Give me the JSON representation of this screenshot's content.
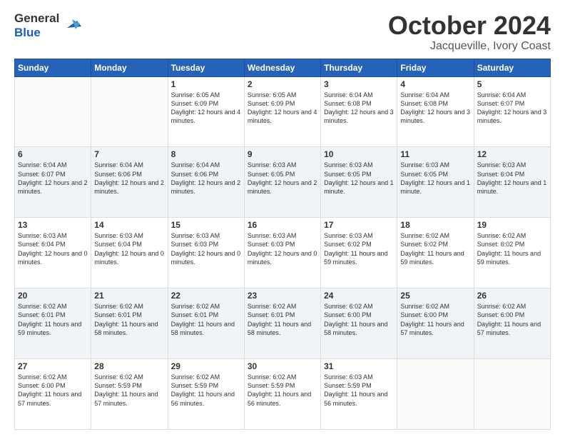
{
  "header": {
    "logo_line1": "General",
    "logo_line2": "Blue",
    "month": "October 2024",
    "location": "Jacqueville, Ivory Coast"
  },
  "days_of_week": [
    "Sunday",
    "Monday",
    "Tuesday",
    "Wednesday",
    "Thursday",
    "Friday",
    "Saturday"
  ],
  "weeks": [
    [
      {
        "day": "",
        "info": ""
      },
      {
        "day": "",
        "info": ""
      },
      {
        "day": "1",
        "info": "Sunrise: 6:05 AM\nSunset: 6:09 PM\nDaylight: 12 hours and 4 minutes."
      },
      {
        "day": "2",
        "info": "Sunrise: 6:05 AM\nSunset: 6:09 PM\nDaylight: 12 hours and 4 minutes."
      },
      {
        "day": "3",
        "info": "Sunrise: 6:04 AM\nSunset: 6:08 PM\nDaylight: 12 hours and 3 minutes."
      },
      {
        "day": "4",
        "info": "Sunrise: 6:04 AM\nSunset: 6:08 PM\nDaylight: 12 hours and 3 minutes."
      },
      {
        "day": "5",
        "info": "Sunrise: 6:04 AM\nSunset: 6:07 PM\nDaylight: 12 hours and 3 minutes."
      }
    ],
    [
      {
        "day": "6",
        "info": "Sunrise: 6:04 AM\nSunset: 6:07 PM\nDaylight: 12 hours and 2 minutes."
      },
      {
        "day": "7",
        "info": "Sunrise: 6:04 AM\nSunset: 6:06 PM\nDaylight: 12 hours and 2 minutes."
      },
      {
        "day": "8",
        "info": "Sunrise: 6:04 AM\nSunset: 6:06 PM\nDaylight: 12 hours and 2 minutes."
      },
      {
        "day": "9",
        "info": "Sunrise: 6:03 AM\nSunset: 6:05 PM\nDaylight: 12 hours and 2 minutes."
      },
      {
        "day": "10",
        "info": "Sunrise: 6:03 AM\nSunset: 6:05 PM\nDaylight: 12 hours and 1 minute."
      },
      {
        "day": "11",
        "info": "Sunrise: 6:03 AM\nSunset: 6:05 PM\nDaylight: 12 hours and 1 minute."
      },
      {
        "day": "12",
        "info": "Sunrise: 6:03 AM\nSunset: 6:04 PM\nDaylight: 12 hours and 1 minute."
      }
    ],
    [
      {
        "day": "13",
        "info": "Sunrise: 6:03 AM\nSunset: 6:04 PM\nDaylight: 12 hours and 0 minutes."
      },
      {
        "day": "14",
        "info": "Sunrise: 6:03 AM\nSunset: 6:04 PM\nDaylight: 12 hours and 0 minutes."
      },
      {
        "day": "15",
        "info": "Sunrise: 6:03 AM\nSunset: 6:03 PM\nDaylight: 12 hours and 0 minutes."
      },
      {
        "day": "16",
        "info": "Sunrise: 6:03 AM\nSunset: 6:03 PM\nDaylight: 12 hours and 0 minutes."
      },
      {
        "day": "17",
        "info": "Sunrise: 6:03 AM\nSunset: 6:02 PM\nDaylight: 11 hours and 59 minutes."
      },
      {
        "day": "18",
        "info": "Sunrise: 6:02 AM\nSunset: 6:02 PM\nDaylight: 11 hours and 59 minutes."
      },
      {
        "day": "19",
        "info": "Sunrise: 6:02 AM\nSunset: 6:02 PM\nDaylight: 11 hours and 59 minutes."
      }
    ],
    [
      {
        "day": "20",
        "info": "Sunrise: 6:02 AM\nSunset: 6:01 PM\nDaylight: 11 hours and 59 minutes."
      },
      {
        "day": "21",
        "info": "Sunrise: 6:02 AM\nSunset: 6:01 PM\nDaylight: 11 hours and 58 minutes."
      },
      {
        "day": "22",
        "info": "Sunrise: 6:02 AM\nSunset: 6:01 PM\nDaylight: 11 hours and 58 minutes."
      },
      {
        "day": "23",
        "info": "Sunrise: 6:02 AM\nSunset: 6:01 PM\nDaylight: 11 hours and 58 minutes."
      },
      {
        "day": "24",
        "info": "Sunrise: 6:02 AM\nSunset: 6:00 PM\nDaylight: 11 hours and 58 minutes."
      },
      {
        "day": "25",
        "info": "Sunrise: 6:02 AM\nSunset: 6:00 PM\nDaylight: 11 hours and 57 minutes."
      },
      {
        "day": "26",
        "info": "Sunrise: 6:02 AM\nSunset: 6:00 PM\nDaylight: 11 hours and 57 minutes."
      }
    ],
    [
      {
        "day": "27",
        "info": "Sunrise: 6:02 AM\nSunset: 6:00 PM\nDaylight: 11 hours and 57 minutes."
      },
      {
        "day": "28",
        "info": "Sunrise: 6:02 AM\nSunset: 5:59 PM\nDaylight: 11 hours and 57 minutes."
      },
      {
        "day": "29",
        "info": "Sunrise: 6:02 AM\nSunset: 5:59 PM\nDaylight: 11 hours and 56 minutes."
      },
      {
        "day": "30",
        "info": "Sunrise: 6:02 AM\nSunset: 5:59 PM\nDaylight: 11 hours and 56 minutes."
      },
      {
        "day": "31",
        "info": "Sunrise: 6:03 AM\nSunset: 5:59 PM\nDaylight: 11 hours and 56 minutes."
      },
      {
        "day": "",
        "info": ""
      },
      {
        "day": "",
        "info": ""
      }
    ]
  ]
}
